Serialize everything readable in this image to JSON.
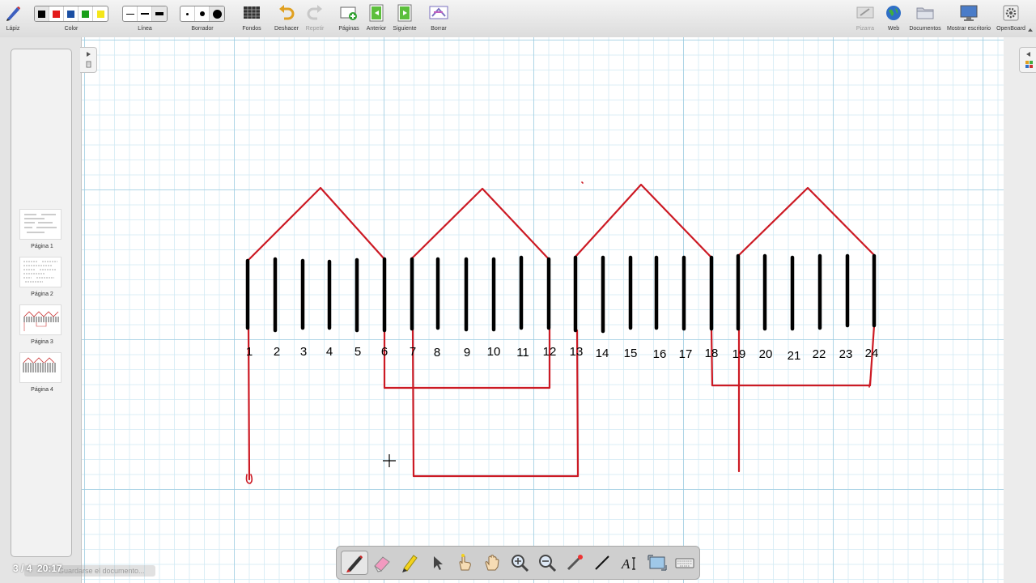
{
  "toolbar": {
    "lapiz": "Lápiz",
    "color": "Color",
    "linea": "Línea",
    "borrador": "Borrador",
    "fondos": "Fondos",
    "deshacer": "Deshacer",
    "repetir": "Repetir",
    "paginas": "Páginas",
    "anterior": "Anterior",
    "siguiente": "Siguiente",
    "borrar": "Borrar",
    "pizarra": "Pizarra",
    "web": "Web",
    "documentos": "Documentos",
    "mostrar_escritorio": "Mostrar escritorio",
    "openboard": "OpenBoard",
    "colors": [
      "#000000",
      "#e31b1b",
      "#1b4fa3",
      "#1aa01a",
      "#f5e61a"
    ]
  },
  "pages": [
    {
      "label": "Página 1"
    },
    {
      "label": "Página 2"
    },
    {
      "label": "Página 3"
    },
    {
      "label": "Página 4"
    }
  ],
  "status": {
    "page": "3 / 4",
    "time": "20:17",
    "message": "Guardarse el documento..."
  },
  "board": {
    "slot_numbers": [
      "1",
      "2",
      "3",
      "4",
      "5",
      "6",
      "7",
      "8",
      "9",
      "10",
      "11",
      "12",
      "13",
      "14",
      "15",
      "16",
      "17",
      "18",
      "19",
      "20",
      "21",
      "22",
      "23",
      "24"
    ],
    "ink_red": "#cc1a24",
    "ink_black": "#000000"
  },
  "stylus_tools": [
    "pen-icon",
    "eraser-icon",
    "highlighter-icon",
    "selector-icon",
    "interactor-icon",
    "hand-icon",
    "zoom-in-icon",
    "zoom-out-icon",
    "laser-pointer-icon",
    "line-icon",
    "text-icon",
    "capture-icon",
    "keyboard-icon"
  ]
}
